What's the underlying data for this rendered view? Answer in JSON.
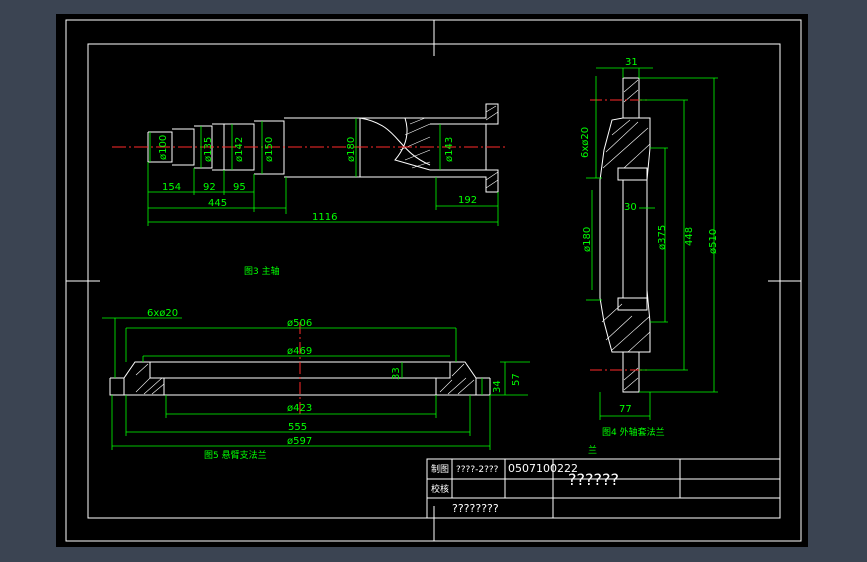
{
  "colors": {
    "background": "#3b4452",
    "canvas": "#000000",
    "outline": "#ffffff",
    "dimension": "#00ff00",
    "centerline": "#ff2a2a",
    "hatch": "#ffffff",
    "label": "#00ff00"
  },
  "shaft": {
    "title": "图3  主轴",
    "dims": {
      "d100": "ø100",
      "d135": "ø135",
      "d142": "ø142",
      "d150": "ø150",
      "d180": "ø180",
      "d143": "ø143",
      "l154": "154",
      "l92": "92",
      "l95": "95",
      "l445": "445",
      "l192": "192",
      "l1116": "1116"
    }
  },
  "flange": {
    "title": "图5  悬臂支法兰",
    "dims": {
      "holes": "6xø20",
      "d506": "ø506",
      "d469": "ø469",
      "d423": "ø423",
      "l555": "555",
      "d597": "ø597",
      "h33": "33",
      "h34": "34",
      "h57": "57"
    }
  },
  "hub": {
    "title": "图4  外轴套法兰",
    "dims": {
      "t31": "31",
      "holes": "6xø20",
      "t30": "30",
      "d180": "ø180",
      "d375": "ø375",
      "d448": "448",
      "d510": "ø510",
      "w77": "77"
    }
  },
  "titleblock": {
    "label_draw": "制图",
    "label_check": "校核",
    "drawer": "????-2???",
    "number": "0507100222",
    "drawing_name": "??????",
    "school": "????????",
    "mark": "兰"
  }
}
